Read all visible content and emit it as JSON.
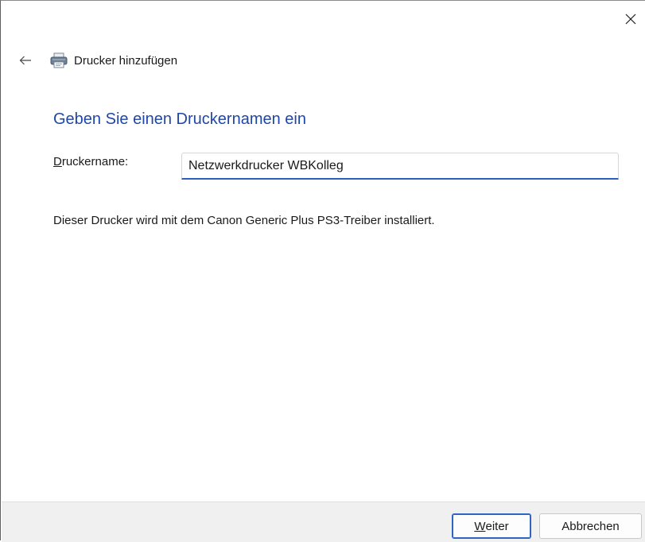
{
  "window": {
    "title": "Drucker hinzufügen"
  },
  "page": {
    "heading": "Geben Sie einen Druckernamen ein",
    "printer_name_label_accel": "D",
    "printer_name_label_rest": "ruckername:",
    "printer_name_value": "Netzwerkdrucker WBKolleg",
    "description": "Dieser Drucker wird mit dem Canon Generic Plus PS3-Treiber installiert."
  },
  "footer": {
    "next_label_accel": "W",
    "next_label_rest": "eiter",
    "cancel_label": "Abbrechen"
  },
  "icons": {
    "close": "close-icon",
    "back": "back-arrow-icon",
    "printer": "printer-icon"
  },
  "colors": {
    "heading": "#1f47a7",
    "accent": "#2f63c4",
    "footer_bg": "#f0f0f0"
  }
}
